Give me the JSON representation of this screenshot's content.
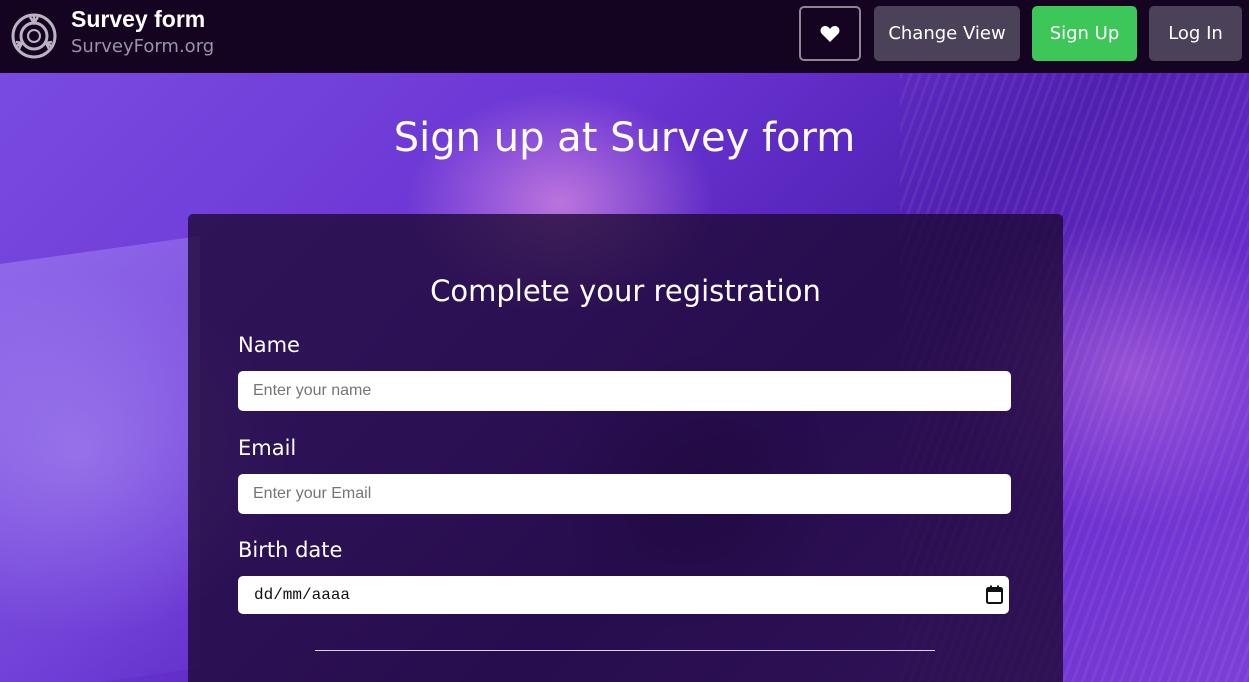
{
  "header": {
    "brand_title": "Survey form",
    "brand_subtitle": "SurveyForm.org",
    "logo_icon": "scp-logo-icon",
    "buttons": {
      "favorite_icon": "heart-icon",
      "change_view": "Change View",
      "sign_up": "Sign Up",
      "log_in": "Log In"
    }
  },
  "main": {
    "title": "Sign up at Survey form"
  },
  "form": {
    "title": "Complete your registration",
    "name": {
      "label": "Name",
      "placeholder": "Enter your name",
      "value": ""
    },
    "email": {
      "label": "Email",
      "placeholder": "Enter your Email",
      "value": ""
    },
    "birth_date": {
      "label": "Birth date",
      "placeholder": "dd/mm/aaaa",
      "icon": "calendar-icon"
    }
  },
  "colors": {
    "header_bg": "#150421",
    "accent_green": "#3dc758",
    "button_gray": "#4b4259",
    "card_bg": "#1c0832"
  }
}
